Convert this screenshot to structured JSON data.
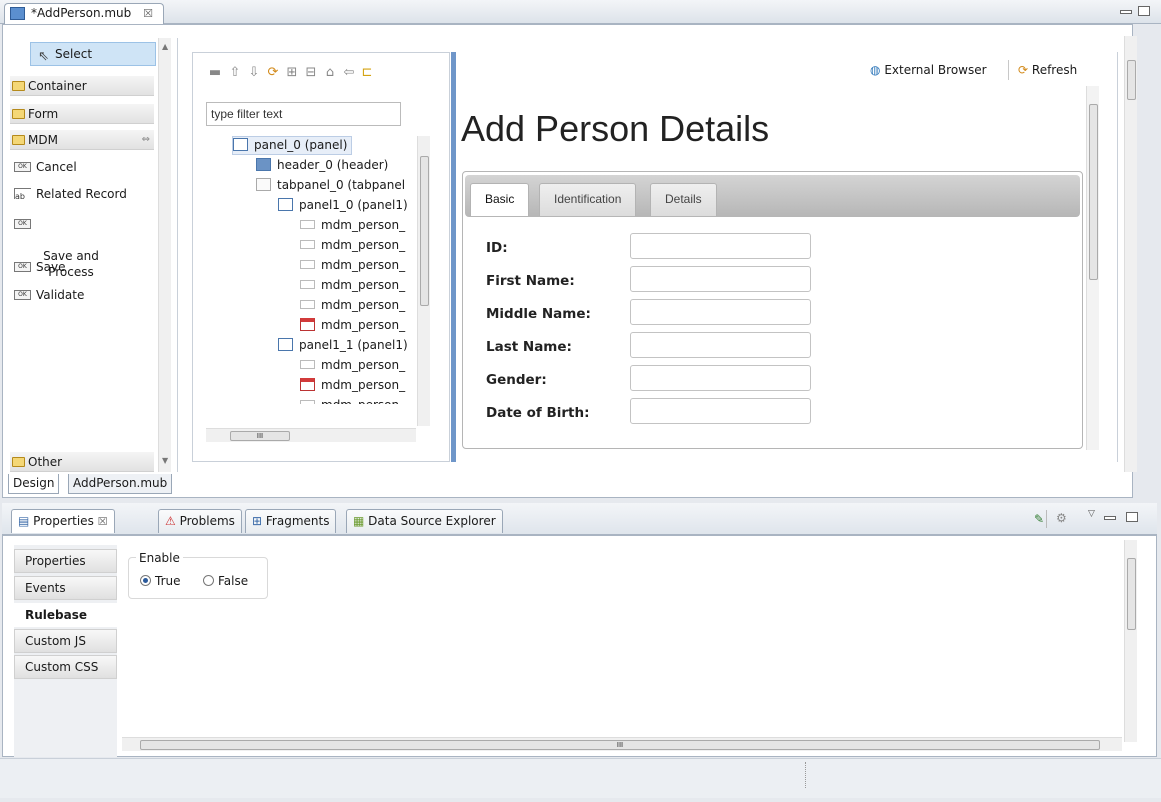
{
  "editor": {
    "tab_title": "*AddPerson.mub",
    "tab_close": "☒"
  },
  "palette": {
    "select_label": "Select",
    "drawers": {
      "container": "Container",
      "form": "Form",
      "mdm": "MDM",
      "other": "Other"
    },
    "mdm_items": [
      "Cancel",
      "Related Record",
      "Save and\nProcess",
      "Save",
      "Validate"
    ],
    "ok_badge": "OK",
    "ab_badge": "ab"
  },
  "outline": {
    "filter_placeholder": "type filter text",
    "tree": [
      {
        "label": "panel_0 (panel)",
        "icon": "panel-icon",
        "depth": 0
      },
      {
        "label": "header_0 (header)",
        "icon": "header-icon",
        "depth": 1
      },
      {
        "label": "tabpanel_0 (tabpanel",
        "icon": "tabpanel-icon",
        "depth": 1
      },
      {
        "label": "panel1_0 (panel1)",
        "icon": "panel-icon",
        "depth": 2
      },
      {
        "label": "mdm_person_",
        "icon": "field-icon",
        "depth": 3
      },
      {
        "label": "mdm_person_",
        "icon": "field-icon",
        "depth": 3
      },
      {
        "label": "mdm_person_",
        "icon": "field-icon",
        "depth": 3
      },
      {
        "label": "mdm_person_",
        "icon": "field-icon",
        "depth": 3
      },
      {
        "label": "mdm_person_",
        "icon": "field-icon",
        "depth": 3
      },
      {
        "label": "mdm_person_",
        "icon": "calendar-icon",
        "depth": 3
      },
      {
        "label": "panel1_1 (panel1)",
        "icon": "panel-icon",
        "depth": 2
      },
      {
        "label": "mdm_person_",
        "icon": "field-icon",
        "depth": 3
      },
      {
        "label": "mdm_person_",
        "icon": "calendar-icon",
        "depth": 3
      },
      {
        "label": "mdm_person",
        "icon": "field-icon",
        "depth": 3
      }
    ],
    "hscroll_grip": "III"
  },
  "preview": {
    "external_browser": "External Browser",
    "refresh": "Refresh",
    "title": "Add Person Details",
    "tabs": [
      "Basic",
      "Identification",
      "Details"
    ],
    "fields": [
      "ID:",
      "First Name:",
      "Middle Name:",
      "Last Name:",
      "Gender:",
      "Date of Birth:"
    ]
  },
  "editor_bottom_tabs": {
    "design": "Design",
    "source": "AddPerson.mub"
  },
  "views": {
    "tabs": [
      "Properties",
      "Problems",
      "Fragments",
      "Data Source Explorer"
    ],
    "properties_close": "☒"
  },
  "properties": {
    "nav": [
      "Properties",
      "Events",
      "Rulebase",
      "Custom JS",
      "Custom CSS"
    ],
    "active_nav": "Rulebase",
    "group_label": "Enable",
    "true_label": "True",
    "false_label": "False",
    "hscroll_grip": "III"
  },
  "colors": {
    "accent": "#6f96c9",
    "selection": "#cfe4f6"
  }
}
